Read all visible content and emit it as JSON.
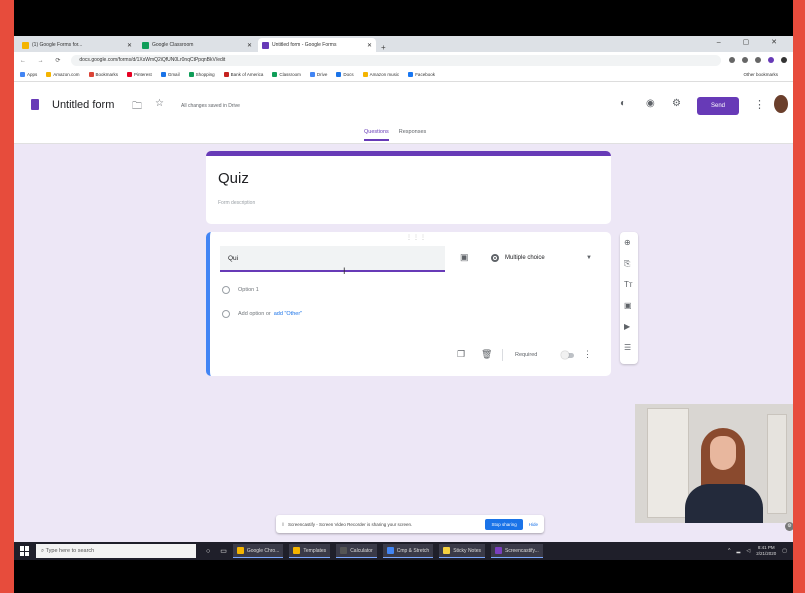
{
  "browser": {
    "tabs": [
      {
        "label": "(1) Google Forms for...",
        "color": "#f4b400"
      },
      {
        "label": "Google Classroom",
        "color": "#0f9d58"
      },
      {
        "label": "Untitled form - Google Forms",
        "color": "#673ab7"
      }
    ],
    "new_tab": "+",
    "window_controls": "– ▢ ✕",
    "url": "docs.google.com/forms/d/1XsWmQ2iQfUN0Lr0nqCtPpqnBkV/edit",
    "nav_icons": "← → ⟳",
    "bookmarks": [
      {
        "label": "Apps",
        "color": "#4285f4"
      },
      {
        "label": "Amazon.com",
        "color": "#f4b400"
      },
      {
        "label": "Bookmarks",
        "color": "#db4437"
      },
      {
        "label": "Pinterest",
        "color": "#e60023"
      },
      {
        "label": "Gmail",
        "color": "#1a73e8"
      },
      {
        "label": "Shopping",
        "color": "#0f9d58"
      },
      {
        "label": "Bank of America",
        "color": "#c5221f"
      },
      {
        "label": "Classroom",
        "color": "#0f9d58"
      },
      {
        "label": "Drive",
        "color": "#4285f4"
      },
      {
        "label": "Docs",
        "color": "#1a73e8"
      },
      {
        "label": "Amazon music",
        "color": "#f4b400"
      },
      {
        "label": "Facebook",
        "color": "#1877f2"
      }
    ],
    "other_bookmarks": "Other bookmarks"
  },
  "forms_header": {
    "title": "Untitled form",
    "save_status": "All changes saved in Drive",
    "send_label": "Send",
    "tabs": {
      "questions": "Questions",
      "responses": "Responses"
    }
  },
  "title_card": {
    "title": "Quiz",
    "description_placeholder": "Form description"
  },
  "question_card": {
    "question_text": "Qui",
    "drag_handle": "⋮⋮⋮",
    "type_label": "Multiple choice",
    "option1": "Option 1",
    "add_option": "Add option",
    "or": "or",
    "add_other": "add \"Other\"",
    "required_label": "Required"
  },
  "notification": {
    "text": "Screencastify - Screen Video Recorder is sharing your screen.",
    "stop_label": "Stop sharing",
    "hide_label": "Hide"
  },
  "taskbar": {
    "search_placeholder": "Type here to search",
    "apps": [
      {
        "label": "Google Chro...",
        "color": "#f4b400"
      },
      {
        "label": "Templates",
        "color": "#f4b400"
      },
      {
        "label": "Calculator",
        "color": "#555555"
      },
      {
        "label": "Cmp & Stretch",
        "color": "#4285f4"
      },
      {
        "label": "Sticky Notes",
        "color": "#f4d03f"
      },
      {
        "label": "Screencastify...",
        "color": "#7b3fbf"
      }
    ],
    "time": "8:41 PM",
    "date": "2/21/2020"
  },
  "colors": {
    "accent": "#673ab7",
    "active_border": "#4285f4",
    "link": "#1a73e8"
  }
}
